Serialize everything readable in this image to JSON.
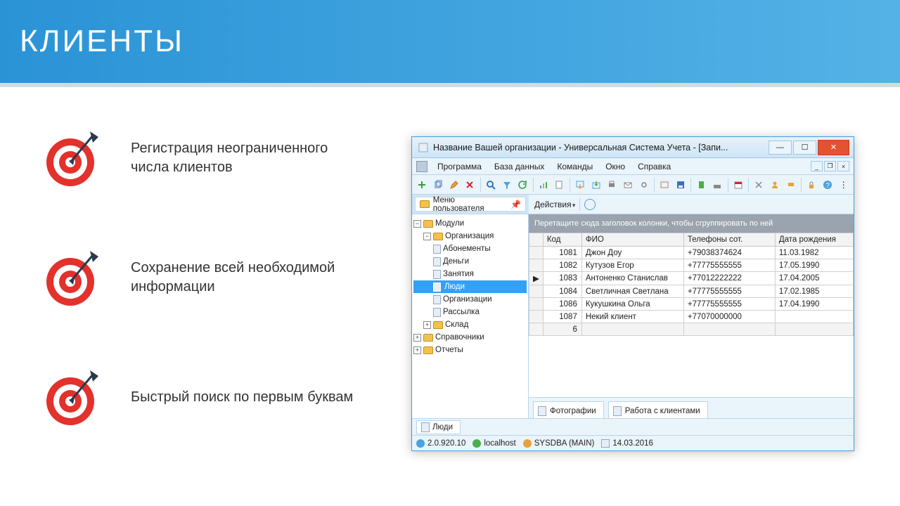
{
  "slide": {
    "title": "КЛИЕНТЫ",
    "bullets": [
      "Регистрация неограниченного числа клиентов",
      "Сохранение всей необходимой информации",
      "Быстрый поиск по первым буквам"
    ]
  },
  "window": {
    "title": "Название Вашей организации - Универсальная Система Учета - [Запи...",
    "menus": [
      "Программа",
      "База данных",
      "Команды",
      "Окно",
      "Справка"
    ],
    "user_menu_label": "Меню пользователя",
    "actions_label": "Действия",
    "group_hint": "Перетащите сюда заголовок колонки, чтобы сгруппировать по ней",
    "columns": [
      "Код",
      "ФИО",
      "Телефоны сот.",
      "Дата рождения"
    ],
    "rows": [
      {
        "code": "1081",
        "name": "Джон Доу",
        "phone": "+79038374624",
        "dob": "11.03.1982"
      },
      {
        "code": "1082",
        "name": "Кутузов Егор",
        "phone": "+77775555555",
        "dob": "17.05.1990"
      },
      {
        "code": "1083",
        "name": "Антоненко Станислав",
        "phone": "+77012222222",
        "dob": "17.04.2005"
      },
      {
        "code": "1084",
        "name": "Светличная Светлана",
        "phone": "+77775555555",
        "dob": "17.02.1985"
      },
      {
        "code": "1086",
        "name": "Кукушкина Ольга",
        "phone": "+77775555555",
        "dob": "17.04.1990"
      },
      {
        "code": "1087",
        "name": "Некий клиент",
        "phone": "+77070000000",
        "dob": ""
      }
    ],
    "row_count": "6",
    "tree": {
      "root": "Модули",
      "org": "Организация",
      "org_children": [
        "Абонементы",
        "Деньги",
        "Занятия",
        "Люди",
        "Организации",
        "Рассылка"
      ],
      "selected": "Люди",
      "sklad": "Склад",
      "sprav": "Справочники",
      "otch": "Отчеты"
    },
    "tabs": [
      "Фотографии",
      "Работа с клиентами"
    ],
    "doc_tab": "Люди",
    "status": {
      "version": "2.0.920.10",
      "host": "localhost",
      "user": "SYSDBA (MAIN)",
      "date": "14.03.2016"
    }
  },
  "colors": {
    "accent": "#34a0f6",
    "close": "#e4532f"
  }
}
